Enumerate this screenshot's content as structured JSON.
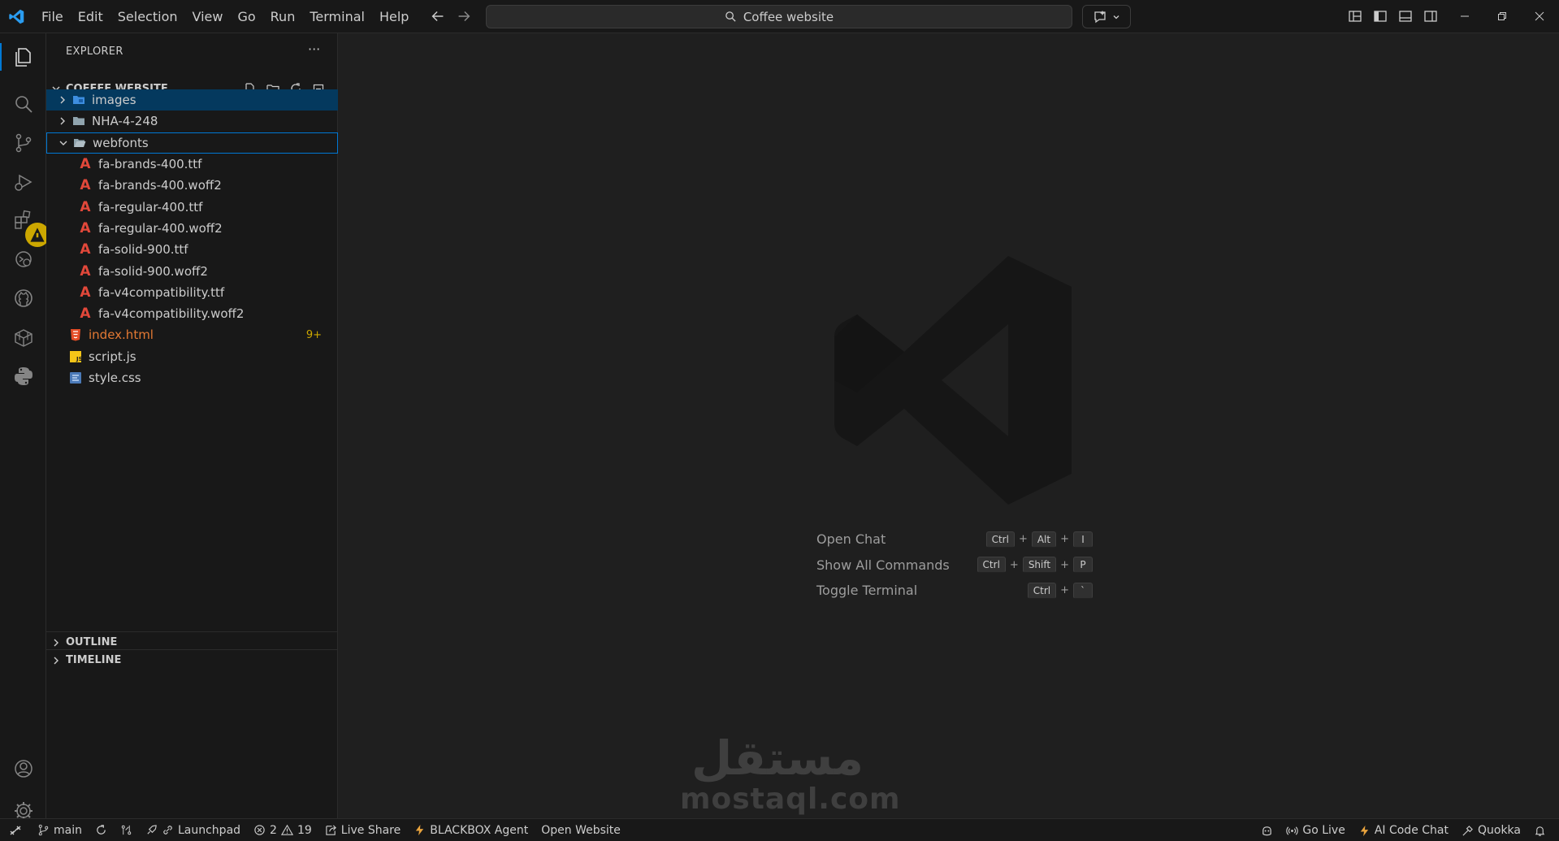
{
  "menu": [
    "File",
    "Edit",
    "Selection",
    "View",
    "Go",
    "Run",
    "Terminal",
    "Help"
  ],
  "search": {
    "text": "Coffee website"
  },
  "explorer": {
    "title": "EXPLORER",
    "more": "···",
    "folder_name": "COFFEE WEBSITE",
    "tree": [
      {
        "label": "images",
        "type": "folder",
        "expanded": false,
        "selected": true
      },
      {
        "label": "NHA-4-248",
        "type": "folder",
        "expanded": false
      },
      {
        "label": "webfonts",
        "type": "folder",
        "expanded": true,
        "focused": true
      },
      {
        "label": "fa-brands-400.ttf",
        "type": "font"
      },
      {
        "label": "fa-brands-400.woff2",
        "type": "font"
      },
      {
        "label": "fa-regular-400.ttf",
        "type": "font"
      },
      {
        "label": "fa-regular-400.woff2",
        "type": "font"
      },
      {
        "label": "fa-solid-900.ttf",
        "type": "font"
      },
      {
        "label": "fa-solid-900.woff2",
        "type": "font"
      },
      {
        "label": "fa-v4compatibility.ttf",
        "type": "font"
      },
      {
        "label": "fa-v4compatibility.woff2",
        "type": "font"
      },
      {
        "label": "index.html",
        "type": "html",
        "badge": "9+"
      },
      {
        "label": "script.js",
        "type": "js"
      },
      {
        "label": "style.css",
        "type": "css"
      }
    ],
    "outline": "OUTLINE",
    "timeline": "TIMELINE"
  },
  "welcome": {
    "shortcuts": [
      {
        "label": "Open Chat",
        "keys": [
          "Ctrl",
          "Alt",
          "I"
        ]
      },
      {
        "label": "Show All Commands",
        "keys": [
          "Ctrl",
          "Shift",
          "P"
        ]
      },
      {
        "label": "Toggle Terminal",
        "keys": [
          "Ctrl",
          "`"
        ]
      }
    ]
  },
  "watermark": {
    "arabic": "مستقل",
    "latin": "mostaql.com"
  },
  "statusbar": {
    "branch": "main",
    "launchpad": "Launchpad",
    "errors": "2",
    "warnings": "19",
    "live_share": "Live Share",
    "blackbox": "BLACKBOX Agent",
    "open_website": "Open Website",
    "go_live": "Go Live",
    "ai_chat": "AI Code Chat",
    "quokka": "Quokka"
  },
  "colors": {
    "accent": "#0078d4",
    "selected_row": "#04395e",
    "font_file": "#e2483a",
    "html_file": "#e37933",
    "warning_badge": "#cca700"
  }
}
